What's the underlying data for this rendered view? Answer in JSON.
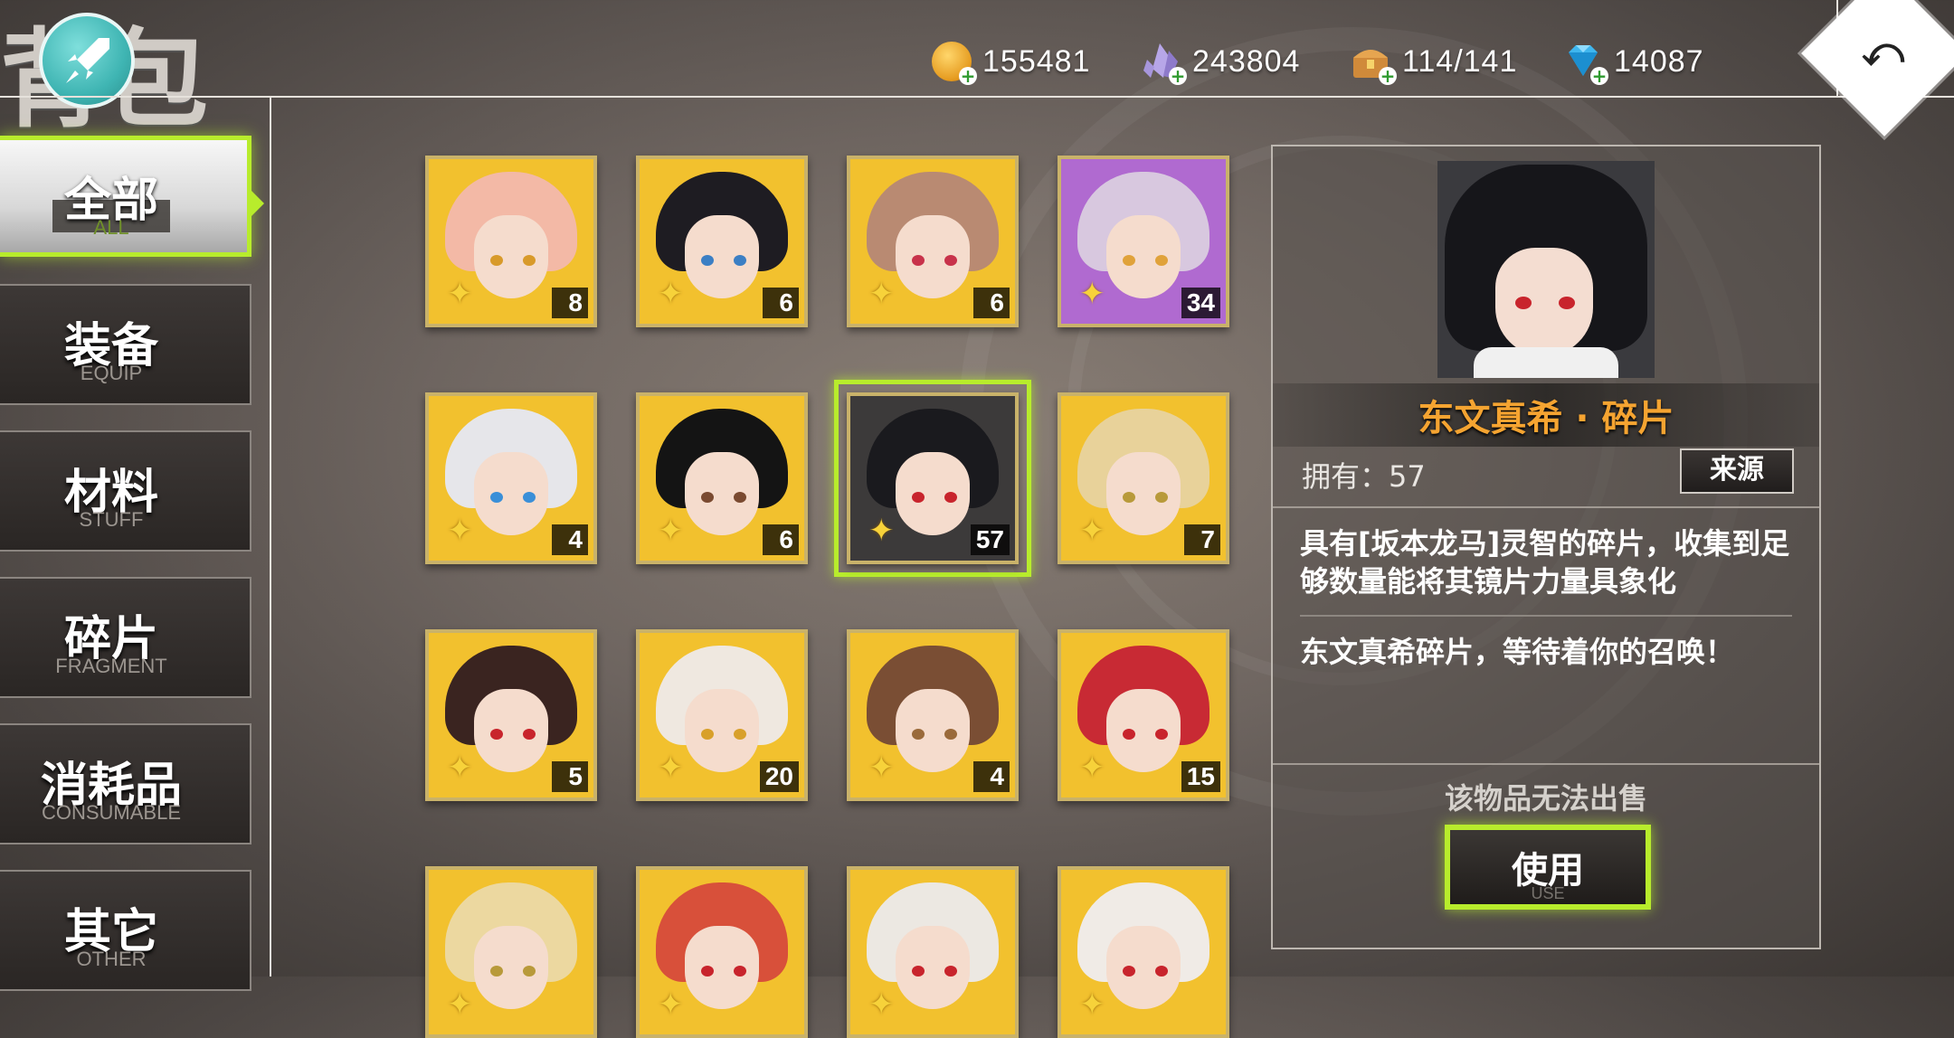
{
  "header": {
    "title": "背包",
    "resources": [
      {
        "icon": "gold-coin-icon",
        "value": "155481"
      },
      {
        "icon": "crystal-icon",
        "value": "243804"
      },
      {
        "icon": "treasure-chest-icon",
        "value": "114/141"
      },
      {
        "icon": "diamond-icon",
        "value": "14087"
      }
    ],
    "back_icon": "return-arrow-icon"
  },
  "sidebar": {
    "items": [
      {
        "cn": "全部",
        "en": "ALL",
        "active": true
      },
      {
        "cn": "装备",
        "en": "EQUIP",
        "active": false
      },
      {
        "cn": "材料",
        "en": "STUFF",
        "active": false
      },
      {
        "cn": "碎片",
        "en": "FRAGMENT",
        "active": false
      },
      {
        "cn": "消耗品",
        "en": "CONSUMABLE",
        "active": false
      },
      {
        "cn": "其它",
        "en": "OTHER",
        "active": false
      }
    ]
  },
  "grid": {
    "items": [
      {
        "count": "8",
        "hair": "#f3b9a6",
        "eye": "#d89a2a",
        "bg": "#f2c12e"
      },
      {
        "count": "6",
        "hair": "#1e1c22",
        "eye": "#3b7fc4",
        "bg": "#f2c12e"
      },
      {
        "count": "6",
        "hair": "#b98a72",
        "eye": "#c8324a",
        "bg": "#f2c12e"
      },
      {
        "count": "34",
        "hair": "#d8c8df",
        "eye": "#e0a23a",
        "bg": "#b06ad0"
      },
      {
        "count": "4",
        "hair": "#e6e6ea",
        "eye": "#3a8fd8",
        "bg": "#f2c12e"
      },
      {
        "count": "6",
        "hair": "#141414",
        "eye": "#7a4a30",
        "bg": "#f2c12e"
      },
      {
        "count": "57",
        "hair": "#1a1a1e",
        "eye": "#c8242c",
        "bg": "#3c3a3a"
      },
      {
        "count": "7",
        "hair": "#e8d29a",
        "eye": "#b89a3a",
        "bg": "#f2c12e"
      },
      {
        "count": "5",
        "hair": "#3a2420",
        "eye": "#c8242c",
        "bg": "#f2c12e"
      },
      {
        "count": "20",
        "hair": "#efe8e0",
        "eye": "#d8a02a",
        "bg": "#f2c12e"
      },
      {
        "count": "4",
        "hair": "#7a4e34",
        "eye": "#9a6a3a",
        "bg": "#f2c12e"
      },
      {
        "count": "15",
        "hair": "#c82a34",
        "eye": "#c8242c",
        "bg": "#f2c12e"
      },
      {
        "count": "",
        "hair": "#ecd8a0",
        "eye": "#b89a3a",
        "bg": "#f2c12e"
      },
      {
        "count": "",
        "hair": "#d8503a",
        "eye": "#c8242c",
        "bg": "#f2c12e"
      },
      {
        "count": "",
        "hair": "#ece8e2",
        "eye": "#c8242c",
        "bg": "#f2c12e"
      },
      {
        "count": "",
        "hair": "#f0ebe6",
        "eye": "#c8242c",
        "bg": "#f2c12e"
      }
    ],
    "selected_index": 6
  },
  "detail": {
    "name": "东文真希 · 碎片",
    "owned": "拥有：57",
    "source_button": "来源",
    "description": "具有[坂本龙马]灵智的碎片，收集到足够数量能将其镜片力量具象化",
    "flavor": "东文真希碎片，等待着你的召唤！",
    "no_sell": "该物品无法出售",
    "use_button": {
      "cn": "使用",
      "en": "USE"
    }
  },
  "colors": {
    "accent": "#b8ec2c",
    "name": "#f5a431"
  }
}
